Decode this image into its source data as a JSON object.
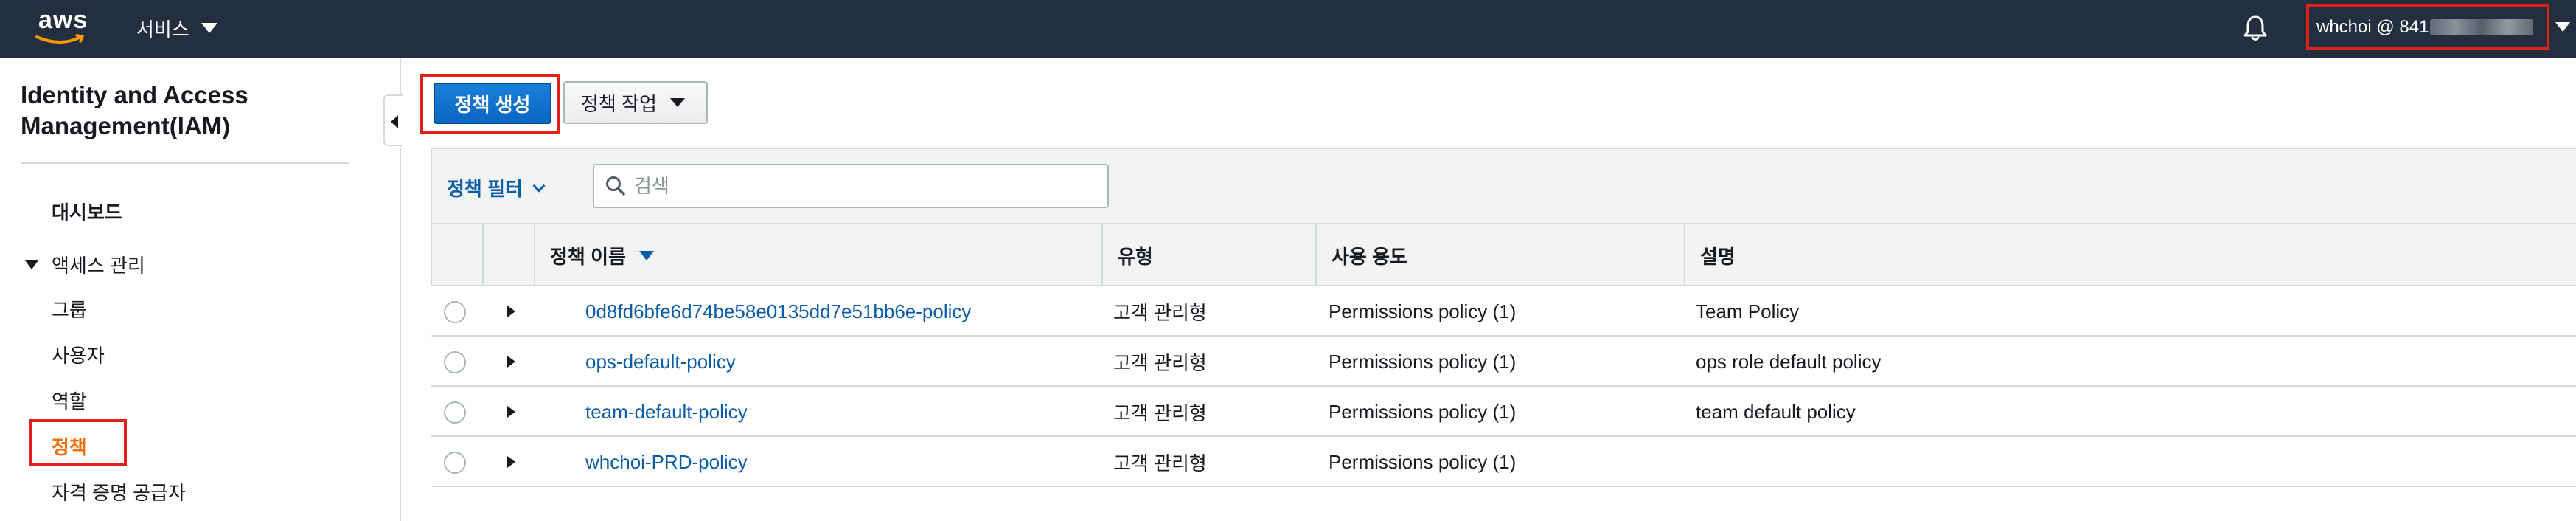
{
  "nav": {
    "logo_text": "aws",
    "services_label": "서비스",
    "account_label": "whchoi @ 841"
  },
  "sidebar": {
    "title": "Identity and Access Management(IAM)",
    "dashboard": "대시보드",
    "section_access": "액세스 관리",
    "items": [
      {
        "label": "그룹"
      },
      {
        "label": "사용자"
      },
      {
        "label": "역할"
      },
      {
        "label": "정책"
      },
      {
        "label": "자격 증명 공급자"
      }
    ]
  },
  "toolbar": {
    "create_label": "정책 생성",
    "actions_label": "정책 작업"
  },
  "filter": {
    "label": "정책 필터",
    "search_placeholder": "검색"
  },
  "table": {
    "headers": {
      "name": "정책 이름",
      "type": "유형",
      "usage": "사용 용도",
      "description": "설명"
    },
    "rows": [
      {
        "name": "0d8fd6bfe6d74be58e0135dd7e51bb6e-policy",
        "type": "고객 관리형",
        "usage": "Permissions policy (1)",
        "description": "Team Policy"
      },
      {
        "name": "ops-default-policy",
        "type": "고객 관리형",
        "usage": "Permissions policy (1)",
        "description": "ops role default policy"
      },
      {
        "name": "team-default-policy",
        "type": "고객 관리형",
        "usage": "Permissions policy (1)",
        "description": "team default policy"
      },
      {
        "name": "whchoi-PRD-policy",
        "type": "고객 관리형",
        "usage": "Permissions policy (1)",
        "description": ""
      }
    ]
  },
  "colors": {
    "nav_bg": "#232f3e",
    "primary_button": "#0972d3",
    "link": "#0a5ca8",
    "active_nav": "#ec7211",
    "highlight_box": "#e1201a"
  },
  "icons": {
    "aws_smile": "aws-smile-icon",
    "bell": "bell-icon",
    "search": "search-icon",
    "collapse": "chevron-left-icon"
  }
}
